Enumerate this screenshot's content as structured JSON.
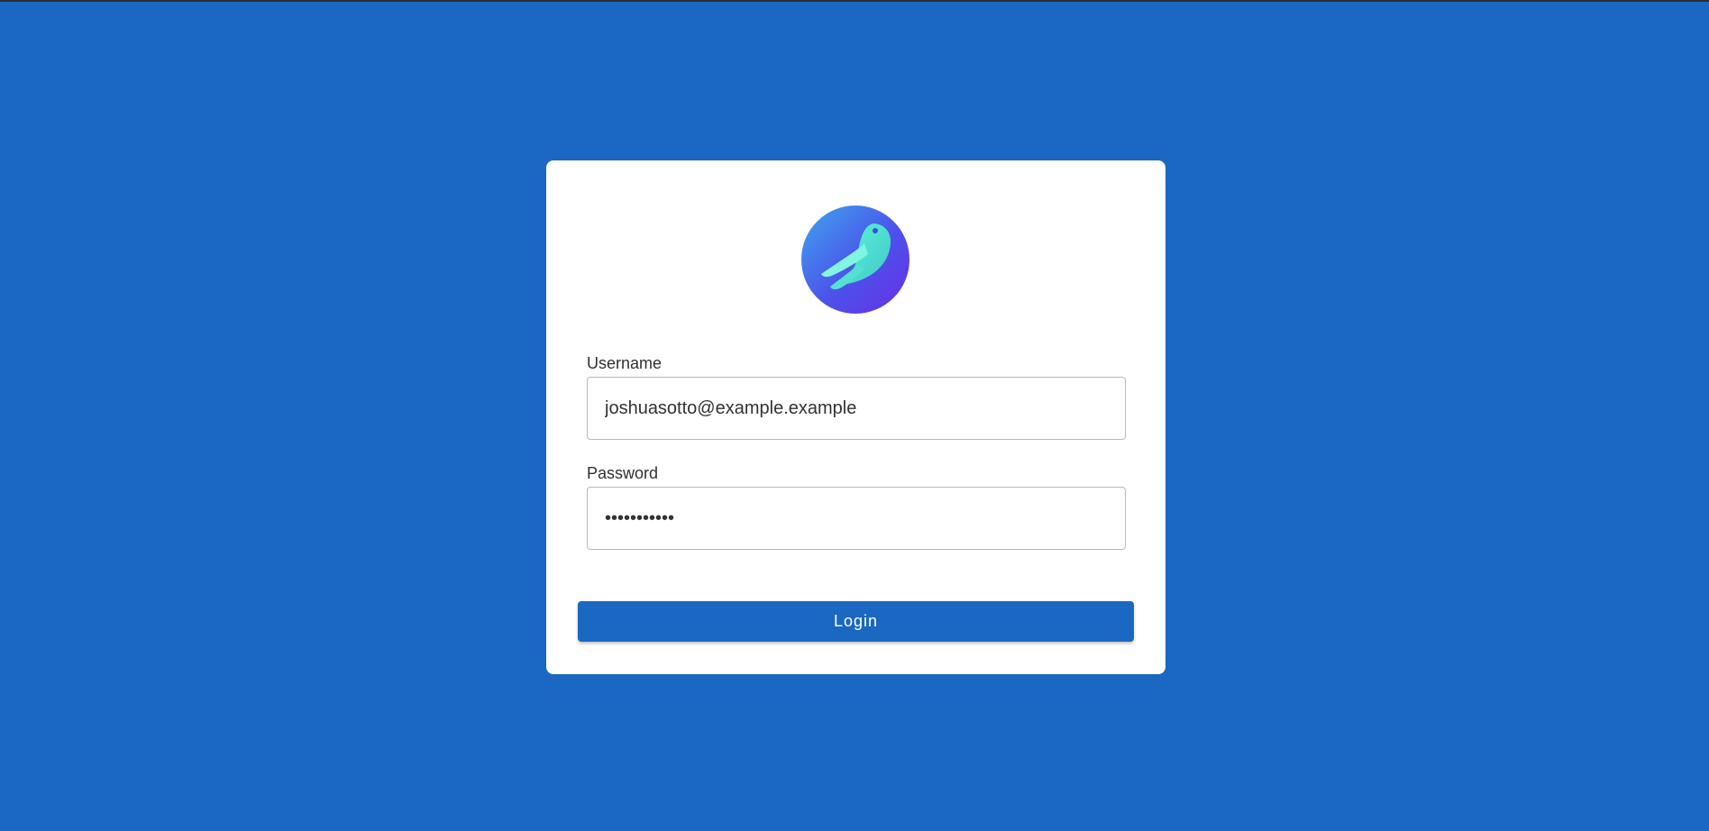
{
  "colors": {
    "background": "#1a68c2",
    "card": "#ffffff",
    "button": "#1a68c2",
    "button_text": "#ffffff"
  },
  "logo": {
    "icon": "bird-logo-icon"
  },
  "form": {
    "username_label": "Username",
    "username_value": "joshuasotto@example.example",
    "password_label": "Password",
    "password_value": "•••••••••••",
    "login_label": "Login"
  }
}
